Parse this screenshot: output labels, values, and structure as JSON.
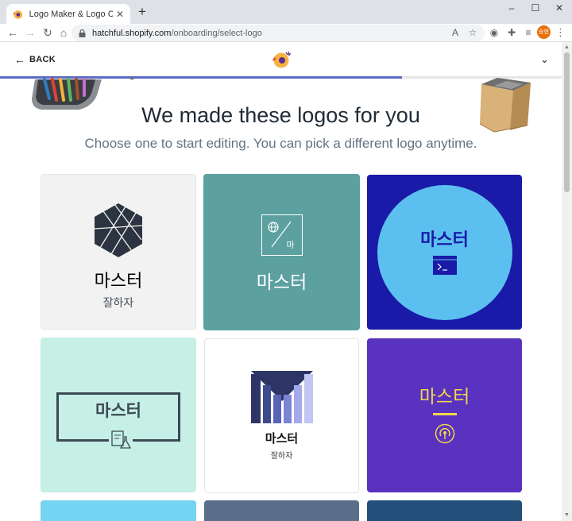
{
  "browser": {
    "tab_title": "Logo Maker & Logo Creator - F",
    "url_host": "hatchful.shopify.com",
    "url_path": "/onboarding/select-logo",
    "profile_label": "승현"
  },
  "header": {
    "back_label": "BACK"
  },
  "intro": {
    "headline": "We made these logos for you",
    "subline": "Choose one to start editing. You can pick a different logo anytime."
  },
  "progress": {
    "value": 0.716
  },
  "logos": [
    {
      "name": "마스터",
      "tagline": "잘하자",
      "bg": "#f2f2f2",
      "text_color": "#212b36"
    },
    {
      "name": "마스터",
      "icon_text": "마",
      "bg": "#5ca0a0",
      "text_color": "#ffffff"
    },
    {
      "name": "마스터",
      "bg": "#1a1aa8",
      "circle": "#5bc0ef",
      "text_color": "#1a1aa8"
    },
    {
      "name": "마스터",
      "bg": "#c6efe6",
      "text_color": "#3d4a55"
    },
    {
      "name": "마스터",
      "tagline": "잘하자",
      "bg": "#ffffff",
      "text_color": "#111111"
    },
    {
      "name": "마스터",
      "bg": "#5a32c0",
      "text_color": "#f2d64b"
    }
  ],
  "partial_cards": [
    {
      "bg": "#74d4f2"
    },
    {
      "bg": "#5a6e8a"
    },
    {
      "bg": "#23507a"
    }
  ],
  "colors": {
    "accent": "#5c6ac4",
    "heading": "#212b36",
    "subtext": "#637381"
  }
}
